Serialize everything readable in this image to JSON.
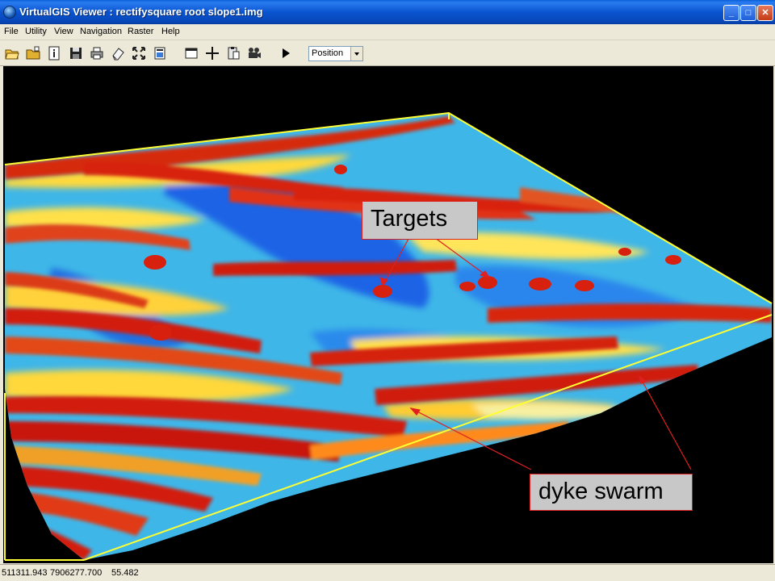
{
  "window": {
    "title": "VirtualGIS Viewer : rectifysquare root slope1.img",
    "controls": {
      "minimize": "_",
      "maximize": "□",
      "close": "✕"
    }
  },
  "menu": {
    "items": [
      "File",
      "Utility",
      "View",
      "Navigation",
      "Raster",
      "Help"
    ]
  },
  "toolbar": {
    "icons": [
      "open-folder-icon",
      "new-folder-icon",
      "info-icon",
      "save-icon",
      "print-icon",
      "eraser-icon",
      "fit-extent-icon",
      "layer-icon",
      "window-icon",
      "crosshair-icon",
      "clipboard-icon",
      "camera-icon",
      "play-icon"
    ],
    "mode_select": {
      "value": "Position"
    }
  },
  "viewport": {
    "annotations": {
      "targets": "Targets",
      "dyke": "dyke swarm"
    },
    "colors": {
      "bounding_box": "#ffff33",
      "leader": "#e02020",
      "high_slope": "#d21a0a",
      "mid_slope": "#f2d21e",
      "low_slope": "#1e64e6"
    }
  },
  "status": {
    "easting": "511311.943",
    "northing": "7906277.700",
    "elevation": "55.482"
  }
}
